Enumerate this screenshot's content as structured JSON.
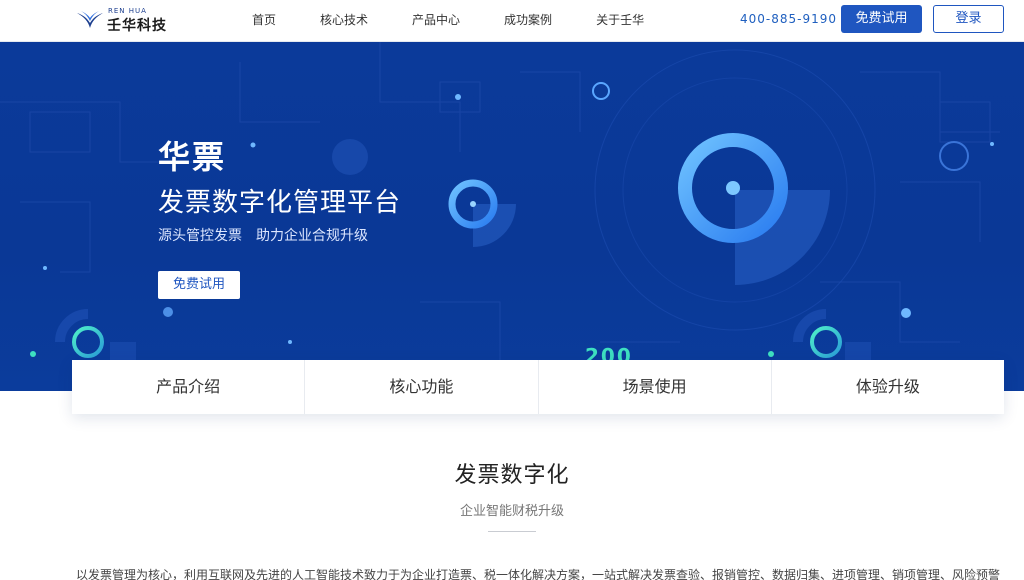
{
  "header": {
    "logo_en": "REN HUA",
    "logo_cn": "壬华科技",
    "nav": [
      "首页",
      "核心技术",
      "产品中心",
      "成功案例",
      "关于壬华"
    ],
    "phone": "400-885-9190",
    "trial_label": "免费试用",
    "login_label": "登录"
  },
  "hero": {
    "title": "华票",
    "subtitle": "发票数字化管理平台",
    "tagline": "源头管控发票　助力企业合规升级",
    "button_label": "免费试用",
    "background_number": "200"
  },
  "tabs": [
    "产品介绍",
    "核心功能",
    "场景使用",
    "体验升级"
  ],
  "section": {
    "title": "发票数字化",
    "subtitle": "企业智能财税升级",
    "description": "以发票管理为核心，利用互联网及先进的人工智能技术致力于为企业打造票、税一体化解决方案，一站式解决发票查验、报销管控、数据归集、进项管理、销项管理、风险预警"
  },
  "colors": {
    "brand": "#1f56c0",
    "hero_bg": "#0b3a9a",
    "accent_cyan": "#3ee0c0"
  }
}
